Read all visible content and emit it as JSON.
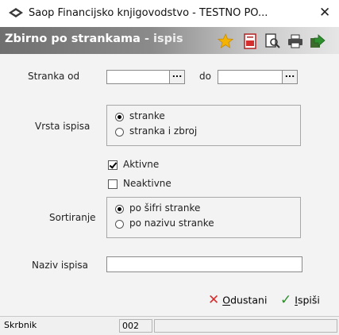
{
  "window": {
    "title": "Saop Financijsko knjigovodstvo - TESTNO PO...",
    "close_glyph": "✕"
  },
  "header": {
    "title": "Zbirno po strankama",
    "subtitle": "- ispis",
    "tools": [
      "favorite-star-icon",
      "pdf-export-icon",
      "print-preview-icon",
      "printer-icon",
      "export-icon"
    ]
  },
  "form": {
    "stranka_od_label": "Stranka od",
    "stranka_od_value": "",
    "do_label": "do",
    "do_value": "",
    "ellipsis": "...",
    "vrsta_ispisa": {
      "label": "Vrsta ispisa",
      "options": [
        "stranke",
        "stranka i zbroj"
      ],
      "selected": "stranke"
    },
    "aktivne": {
      "label": "Aktivne",
      "checked": true
    },
    "neaktivne": {
      "label": "Neaktivne",
      "checked": false
    },
    "sortiranje": {
      "label": "Sortiranje",
      "options": [
        "po šifri stranke",
        "po nazivu stranke"
      ],
      "selected": "po šifri stranke"
    },
    "naziv_ispisa_label": "Naziv ispisa",
    "naziv_ispisa_value": ""
  },
  "buttons": {
    "cancel_hotkey": "O",
    "cancel_rest": "dustani",
    "print_hotkey": "I",
    "print_rest": "spiši"
  },
  "statusbar": {
    "user": "Skrbnik",
    "code": "002",
    "extra": ""
  },
  "colors": {
    "header_gradient_start": "#6f6f6f",
    "header_gradient_end": "#e6e6e6",
    "content_bg": "#f3f3f3",
    "cancel_icon": "#d32f2f",
    "print_icon": "#2e8b2e"
  }
}
